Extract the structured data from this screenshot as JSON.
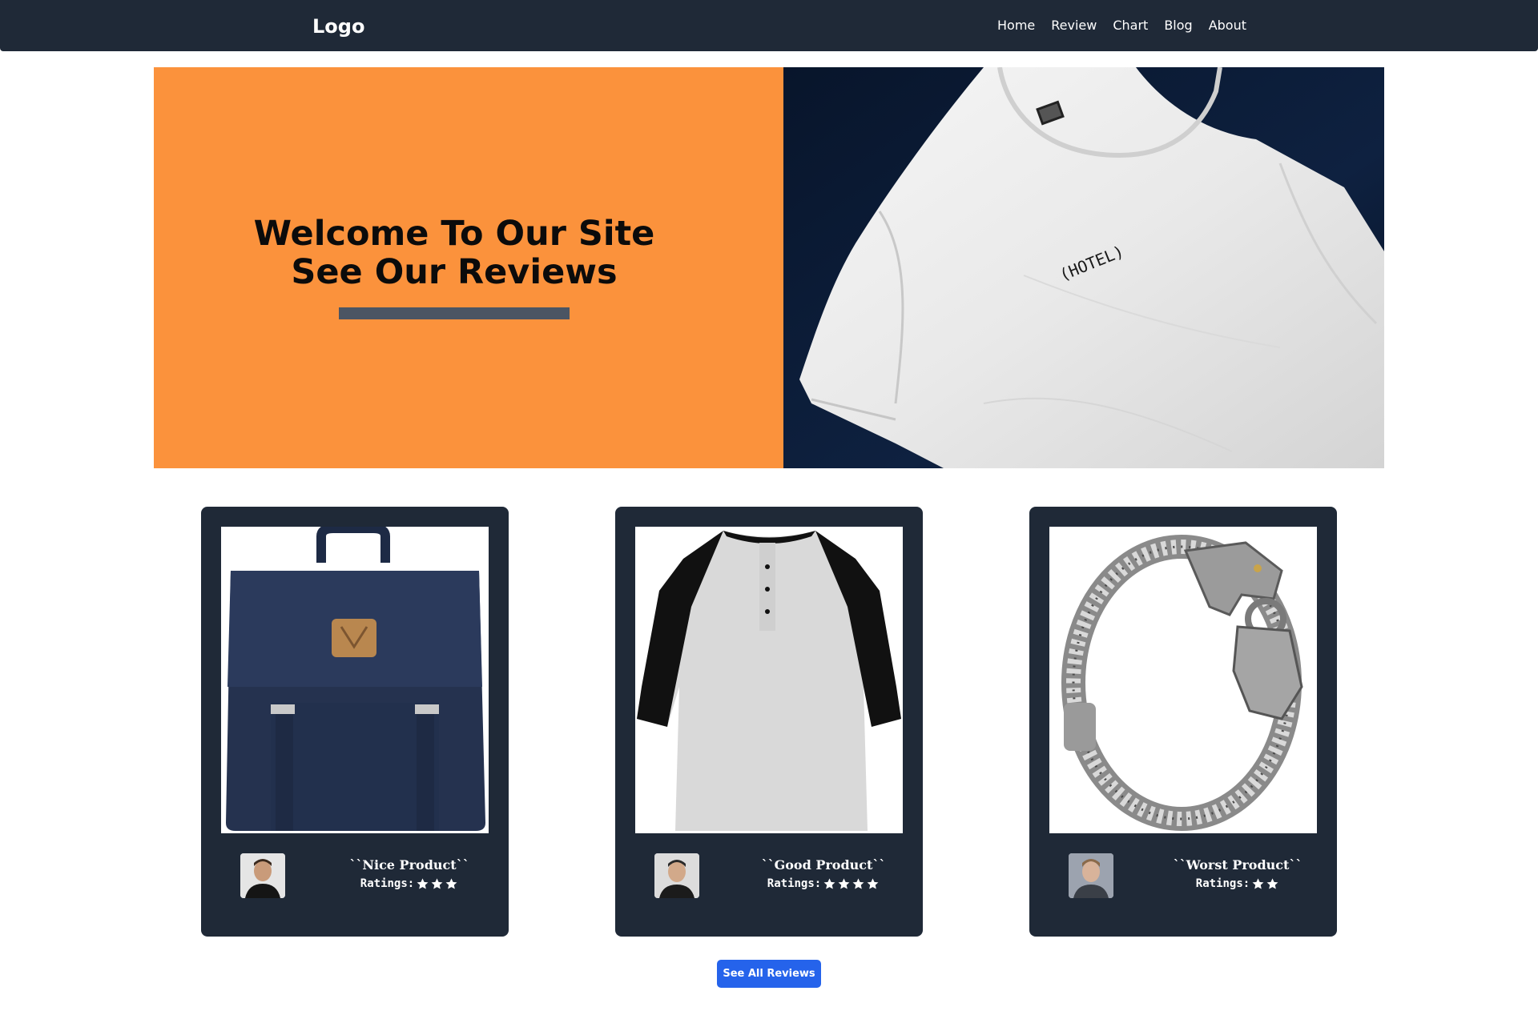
{
  "nav": {
    "logo": "Logo",
    "links": [
      "Home",
      "Review",
      "Chart",
      "Blog",
      "About"
    ]
  },
  "hero": {
    "title_line1": "Welcome To Our Site",
    "title_line2": "See Our Reviews",
    "tshirt_text": "(HOTEL)"
  },
  "colors": {
    "navbar": "#1f2937",
    "hero_orange": "#fb923c",
    "hero_bar": "#4b5563",
    "card_bg": "#1f2937",
    "button_blue": "#2563eb"
  },
  "reviews": [
    {
      "product_icon": "backpack-icon",
      "quote": "``Nice Product``",
      "ratings_label": "Ratings:",
      "stars": 3
    },
    {
      "product_icon": "raglan-shirt-icon",
      "quote": "``Good Product``",
      "ratings_label": "Ratings:",
      "stars": 4
    },
    {
      "product_icon": "chain-bracelet-icon",
      "quote": "``Worst Product``",
      "ratings_label": "Ratings:",
      "stars": 2
    }
  ],
  "cta": {
    "label": "See All Reviews"
  }
}
